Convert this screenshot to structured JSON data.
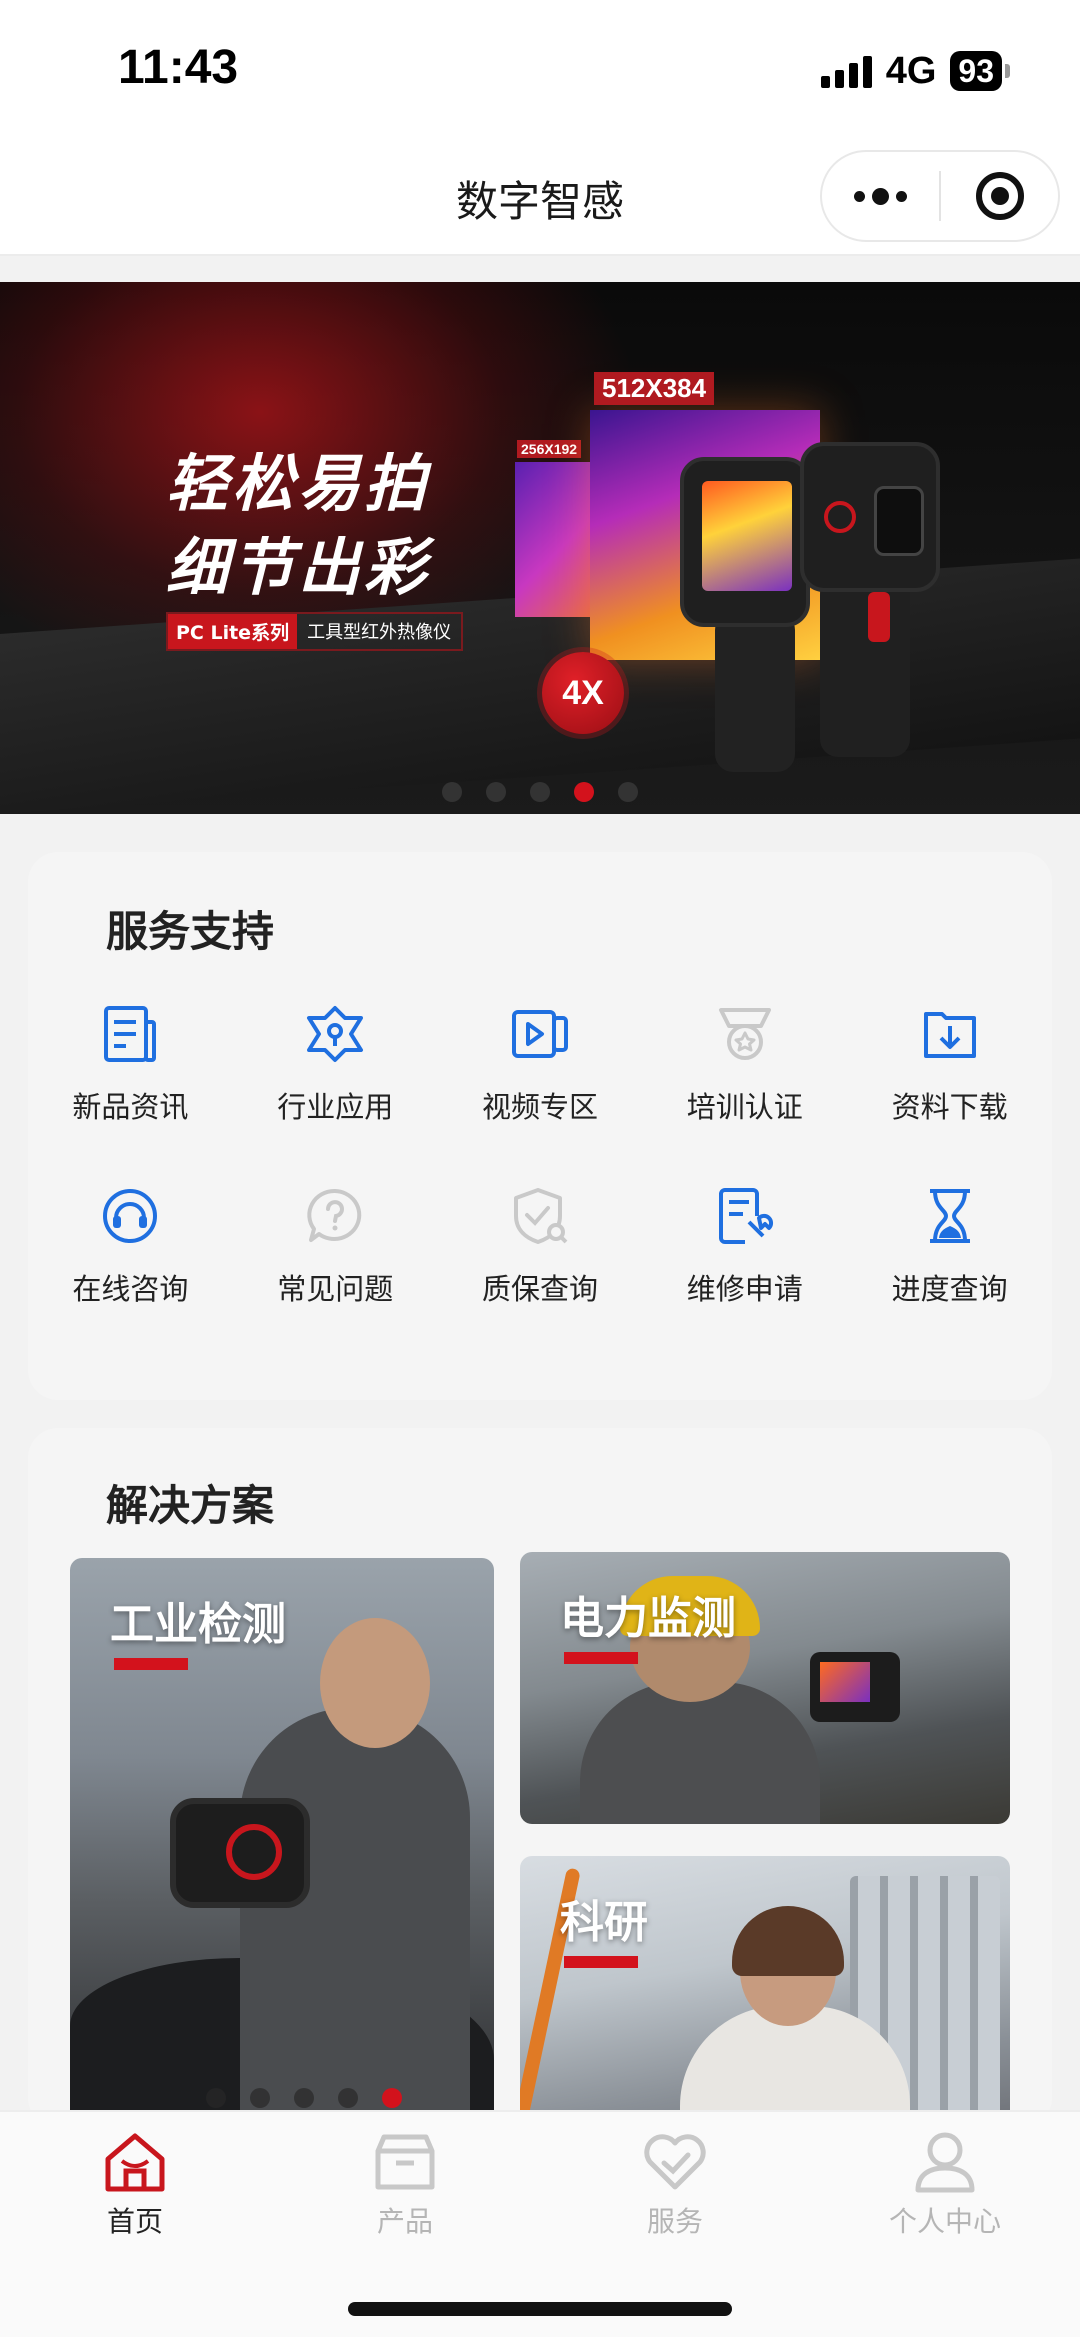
{
  "status_bar": {
    "time": "11:43",
    "network": "4G",
    "battery": "93"
  },
  "nav": {
    "title": "数字智感",
    "more_icon": "more-dots-icon",
    "close_icon": "mini-program-close-icon"
  },
  "banner": {
    "headline_line1": "轻松易拍",
    "headline_line2": "细节出彩",
    "series_tag": "PC Lite系列",
    "series_desc": "工具型红外热像仪",
    "resolution_small": "256X192",
    "resolution_large": "512X384",
    "zoom_badge": "4X",
    "slide_count": 5,
    "active_slide": 4
  },
  "service": {
    "title": "服务支持",
    "items": [
      {
        "label": "新品资讯",
        "icon": "news-icon",
        "color": "#1f6fe0"
      },
      {
        "label": "行业应用",
        "icon": "industry-app-icon",
        "color": "#1f6fe0"
      },
      {
        "label": "视频专区",
        "icon": "video-icon",
        "color": "#1f6fe0"
      },
      {
        "label": "培训认证",
        "icon": "certificate-icon",
        "color": "#c9c9c9"
      },
      {
        "label": "资料下载",
        "icon": "download-icon",
        "color": "#1f6fe0"
      },
      {
        "label": "在线咨询",
        "icon": "headset-icon",
        "color": "#1f6fe0"
      },
      {
        "label": "常见问题",
        "icon": "question-icon",
        "color": "#c9c9c9"
      },
      {
        "label": "质保查询",
        "icon": "warranty-shield-icon",
        "color": "#c9c9c9"
      },
      {
        "label": "维修申请",
        "icon": "repair-form-icon",
        "color": "#1f6fe0"
      },
      {
        "label": "进度查询",
        "icon": "hourglass-icon",
        "color": "#1f6fe0"
      }
    ]
  },
  "solutions": {
    "title": "解决方案",
    "tiles": [
      {
        "label": "工业检测"
      },
      {
        "label": "电力监测"
      },
      {
        "label": "科研"
      }
    ],
    "slide_count": 5,
    "active_slide": 5
  },
  "tab_bar": {
    "tabs": [
      {
        "label": "首页",
        "icon": "home-icon",
        "active": true
      },
      {
        "label": "产品",
        "icon": "box-icon",
        "active": false
      },
      {
        "label": "服务",
        "icon": "heart-check-icon",
        "active": false
      },
      {
        "label": "个人中心",
        "icon": "user-icon",
        "active": false
      }
    ]
  },
  "colors": {
    "accent_red": "#d3121c",
    "service_blue": "#1f6fe0",
    "disabled_gray": "#c9c9c9"
  }
}
